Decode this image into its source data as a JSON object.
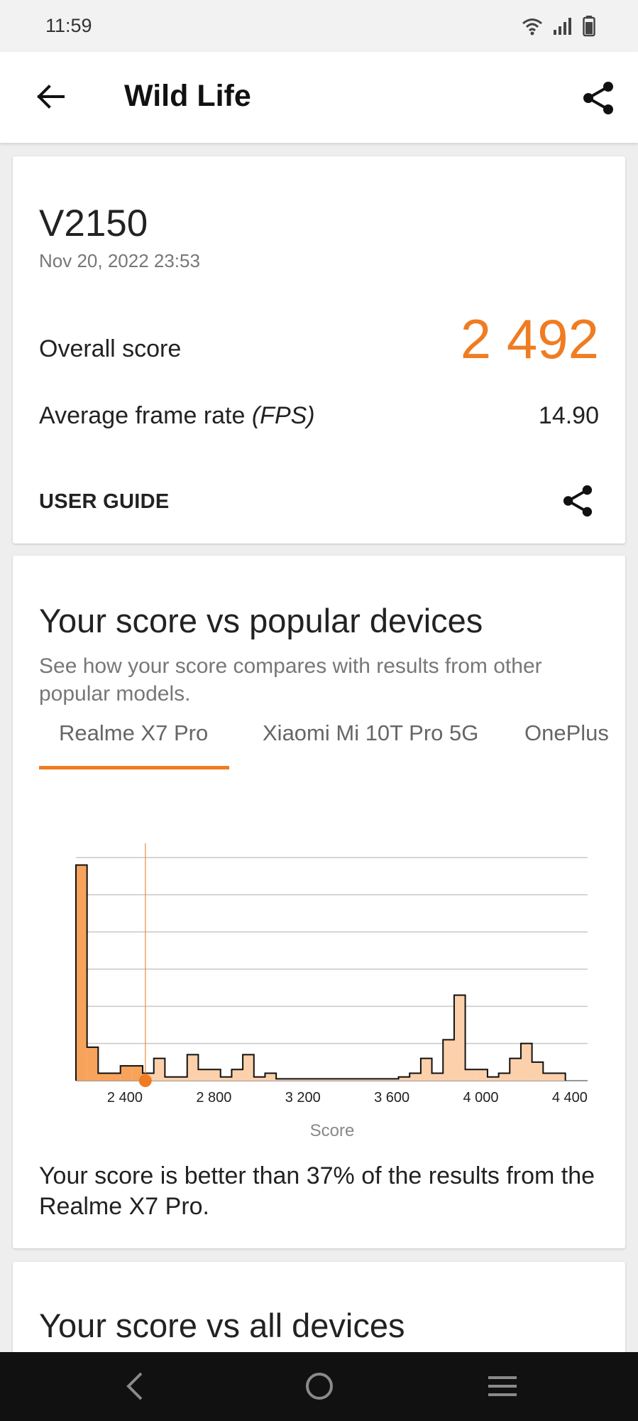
{
  "status_bar": {
    "time": "11:59",
    "icons": [
      "wifi-icon",
      "signal-icon",
      "battery-icon"
    ]
  },
  "app_bar": {
    "title": "Wild Life",
    "icons": [
      "back-arrow-icon",
      "share-icon"
    ]
  },
  "result_card": {
    "device": "V2150",
    "date": "Nov 20, 2022 23:53",
    "overall_score_label": "Overall score",
    "overall_score": "2 492",
    "fps_label_plain": "Average frame rate ",
    "fps_label_italic": "(FPS)",
    "fps_value": "14.90",
    "user_guide_label": "USER GUIDE"
  },
  "popular_section": {
    "title": "Your score vs popular devices",
    "subtitle": "See how your score compares with results from other popular models.",
    "tabs": [
      {
        "label": "Realme X7 Pro",
        "selected": true
      },
      {
        "label": "Xiaomi Mi 10T Pro 5G",
        "selected": false
      },
      {
        "label": "OnePlus",
        "selected": false
      }
    ],
    "result_text": "Your score is better than 37% of the results from the Realme X7 Pro."
  },
  "chart_data": {
    "type": "area",
    "xlabel": "Score",
    "ylabel": "",
    "x_ticks": [
      "2 400",
      "2 800",
      "3 200",
      "3 600",
      "4 000",
      "4 400"
    ],
    "x_tick_values": [
      2400,
      2800,
      3200,
      3600,
      4000,
      4400
    ],
    "xlim": [
      2180,
      4480
    ],
    "ylim": [
      0,
      6
    ],
    "grid": true,
    "bin_width": 50,
    "bins_start": 2180,
    "values": [
      5.8,
      0.9,
      0.2,
      0.2,
      0.4,
      0.4,
      0.2,
      0.6,
      0.1,
      0.1,
      0.7,
      0.3,
      0.3,
      0.1,
      0.3,
      0.7,
      0.1,
      0.2,
      0.05,
      0.05,
      0.05,
      0.05,
      0.05,
      0.05,
      0.05,
      0.05,
      0.05,
      0.05,
      0.05,
      0.1,
      0.2,
      0.6,
      0.2,
      1.1,
      2.3,
      0.3,
      0.3,
      0.1,
      0.2,
      0.6,
      1.0,
      0.5,
      0.2,
      0.2
    ],
    "your_score": 2492,
    "highlight_color": "#f7a35c",
    "fill_color": "#fbd0aa",
    "marker_color": "#f07c22"
  },
  "all_section": {
    "title": "Your score vs all devices"
  },
  "nav_bar": {
    "icons": [
      "nav-back-icon",
      "nav-home-icon",
      "nav-menu-icon"
    ]
  },
  "colors": {
    "accent": "#f07c22"
  }
}
